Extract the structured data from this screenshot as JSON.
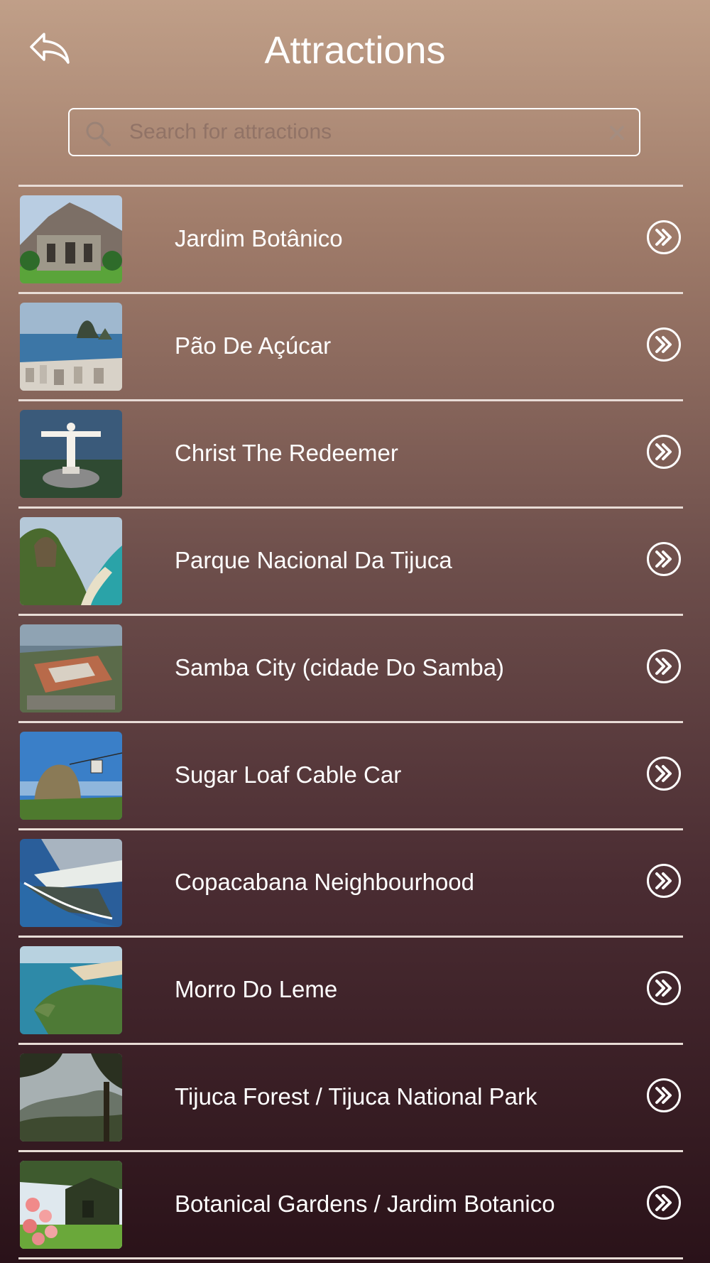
{
  "header": {
    "title": "Attractions",
    "back_icon": "back-arrow-icon"
  },
  "search": {
    "placeholder": "Search for attractions",
    "value": ""
  },
  "colors": {
    "gradient_top": "#c09f88",
    "gradient_bottom": "#2a1219",
    "divider": "#e8dcd6",
    "text": "#ffffff"
  },
  "attractions": [
    {
      "label": "Jardim Botânico",
      "thumb_icon": "botanical-building-photo"
    },
    {
      "label": "Pão De Açúcar",
      "thumb_icon": "sugarloaf-bay-photo"
    },
    {
      "label": "Christ The Redeemer",
      "thumb_icon": "christ-statue-photo"
    },
    {
      "label": "Parque Nacional Da Tijuca",
      "thumb_icon": "mountain-coast-photo"
    },
    {
      "label": "Samba City (cidade Do Samba)",
      "thumb_icon": "samba-city-aerial-photo"
    },
    {
      "label": "Sugar Loaf Cable Car",
      "thumb_icon": "cable-car-photo"
    },
    {
      "label": "Copacabana Neighbourhood",
      "thumb_icon": "copacabana-aerial-photo"
    },
    {
      "label": "Morro Do Leme",
      "thumb_icon": "morro-do-leme-photo"
    },
    {
      "label": "Tijuca Forest / Tijuca National Park",
      "thumb_icon": "forest-view-photo"
    },
    {
      "label": "Botanical Gardens / Jardim Botanico",
      "thumb_icon": "garden-flowers-photo"
    }
  ]
}
